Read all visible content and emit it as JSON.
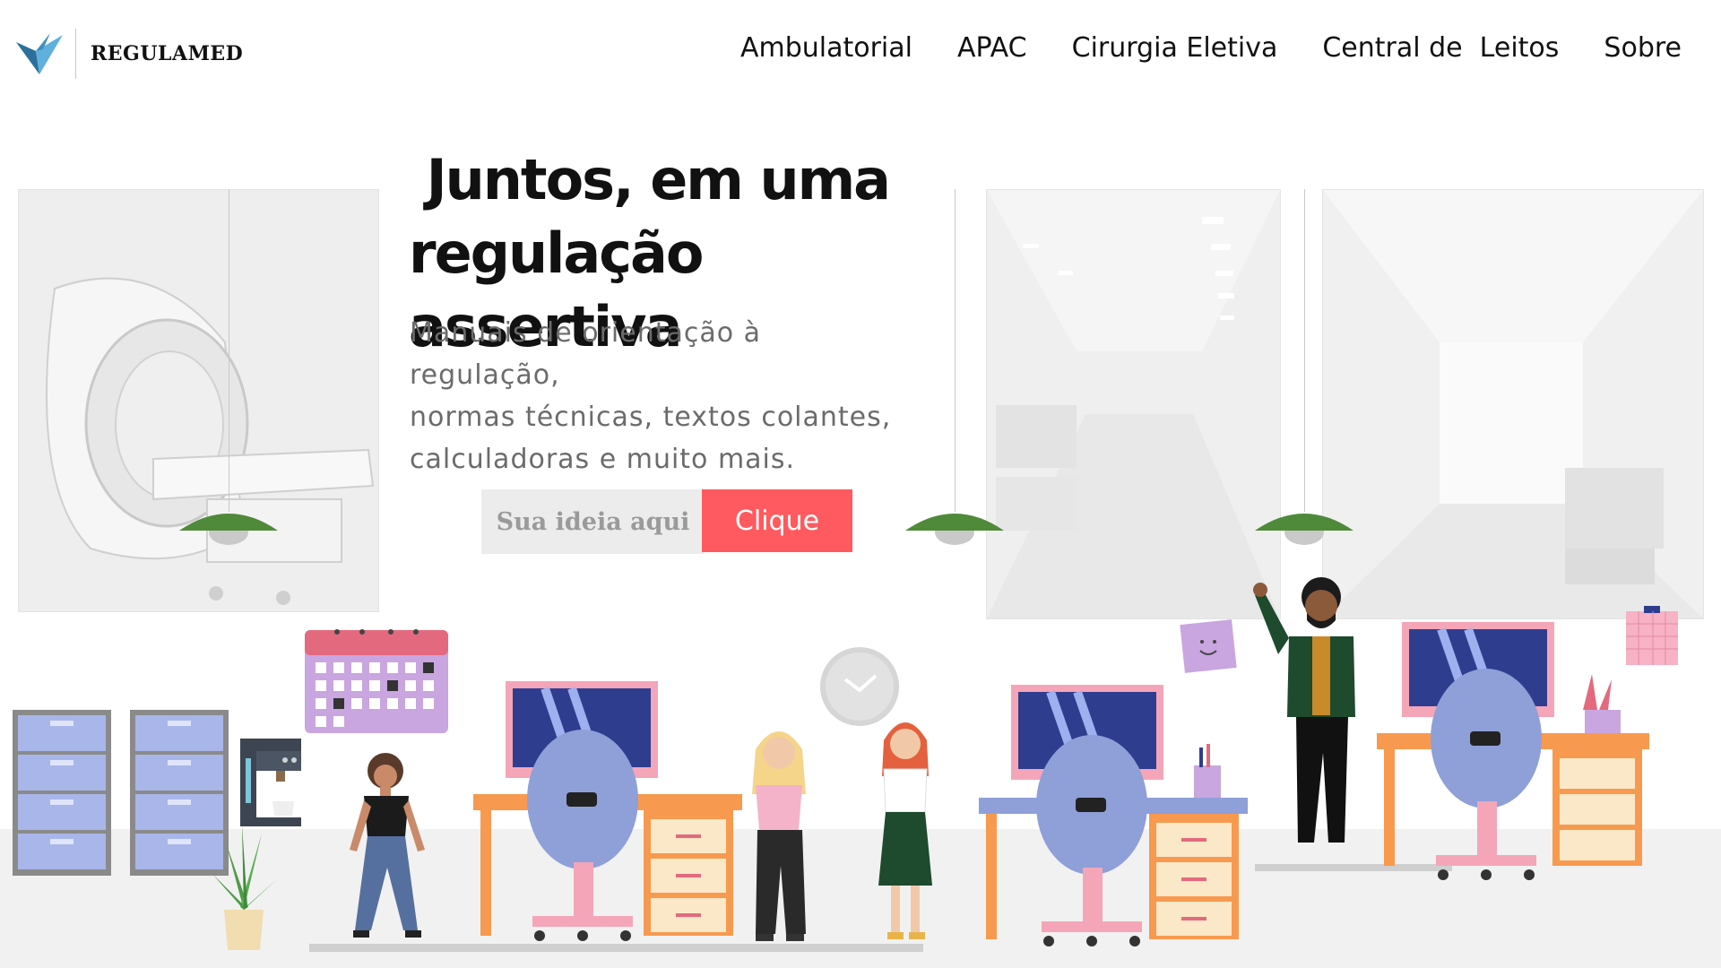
{
  "brand": {
    "name": "REGULAMED"
  },
  "nav": {
    "items": [
      {
        "label": "Ambulatorial"
      },
      {
        "label": "APAC"
      },
      {
        "label": "Cirurgia Eletiva"
      },
      {
        "label": "Central de  Leitos"
      },
      {
        "label": "Sobre"
      }
    ]
  },
  "hero": {
    "title_line1": " Juntos, em uma",
    "title_line2": "regulação assertiva",
    "subtitle_line1": "Manuais de orientação à regulação,",
    "subtitle_line2": "normas técnicas, textos colantes,",
    "subtitle_line3": "calculadoras e muito mais."
  },
  "search": {
    "placeholder": "Sua ideia aqui",
    "button_label": "Clique"
  },
  "colors": {
    "accent": "#ff5a5f",
    "lamp": "#4f8a3a",
    "desk": "#f79a4f",
    "monitor": "#2f3d8f",
    "chair": "#8f9fd8",
    "calendar": "#c9a6e0"
  }
}
